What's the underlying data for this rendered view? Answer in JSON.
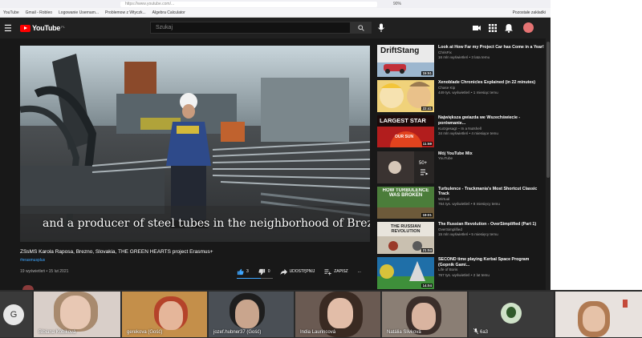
{
  "browser": {
    "url": "https://www.youtube.com/...",
    "zoom": "90%",
    "bookmarks": [
      "YouTube",
      "Gmail - Robleo",
      "Logowanie Usernam...",
      "Problemow z Wtyczk...",
      "Algebra Calculator",
      "Pozostałe zakładki"
    ]
  },
  "header": {
    "logo_text": "YouTube",
    "logo_country": "PL",
    "search_placeholder": "Szukaj"
  },
  "video": {
    "caption": "and a producer of steel tubes in the neighborhood of Brezno",
    "title": "ZSsMS Karola Raposa, Brezno, Slovakia, THE GREEN HEARTS project Erasmus+",
    "hashtag": "#erasmusplus",
    "views_date": "19 wyświetleń • 15 lut 2021",
    "likes": "3",
    "dislikes": "0",
    "share_label": "UDOSTĘPNIJ",
    "save_label": "ZAPISZ",
    "more_label": "..."
  },
  "sidebar": [
    {
      "title": "Look at How Far my Project Car has Come in a Year!",
      "channel": "ChrisFix",
      "views": "16 mln wyświetleń • 3 lata temu",
      "duration": "15:51",
      "thumb_text": "DriftStang"
    },
    {
      "title": "Xenoblade Chronicles Explained (in 22 minutes)",
      "channel": "Chase Kip",
      "views": "449 tys. wyświetleń • 1 miesiąc temu",
      "duration": "22:41",
      "thumb_text": ""
    },
    {
      "title": "Największa gwiazda we Wszechświecie - porównanie...",
      "channel": "Kurzgesagt – In a Nutshell",
      "views": "34 mln wyświetleń • 4 miesiące temu",
      "duration": "11:59",
      "thumb_text": "LARGEST STAR",
      "thumb_sub": "OUR SUN"
    },
    {
      "title": "Mój YouTube Mix",
      "channel": "YouTube",
      "views": "",
      "duration": "",
      "thumb_text": "",
      "mix_count": "50+"
    },
    {
      "title": "Turbulence - Trackmania's Most Shortcut Classic Track",
      "channel": "Wirtual",
      "views": "764 tys. wyświetleń • 8 miesięcy temu",
      "duration": "19:01",
      "thumb_text": "HOW TURBULENCE WAS BROKEN"
    },
    {
      "title": "The Russian Revolution - OverSimplified (Part 1)",
      "channel": "OverSimplified",
      "views": "15 mln wyświetleń • 5 miesięcy temu",
      "duration": "21:04",
      "thumb_text": "THE RUSSIAN REVOLUTION"
    },
    {
      "title": "SECOND time playing Kerbal Space Program (Gopnik Gami...",
      "channel": "Life of Boris",
      "views": "767 tys. wyświetleń • 2 lat temu",
      "duration": "14:04",
      "thumb_text": ""
    }
  ],
  "participants": [
    {
      "initial": "G",
      "name": ""
    },
    {
      "name": "Bibiana Kobiková"
    },
    {
      "name": "gerekova (Gość)"
    },
    {
      "name": "jozef.hubner37 (Gość)"
    },
    {
      "name": "India Laurincová"
    },
    {
      "name": "Natália Slivková"
    },
    {
      "name": "6a3"
    },
    {
      "name": ""
    }
  ],
  "colors": {
    "yt_red": "#ff0000",
    "yt_bg": "#181818",
    "link_blue": "#3ea6ff"
  }
}
